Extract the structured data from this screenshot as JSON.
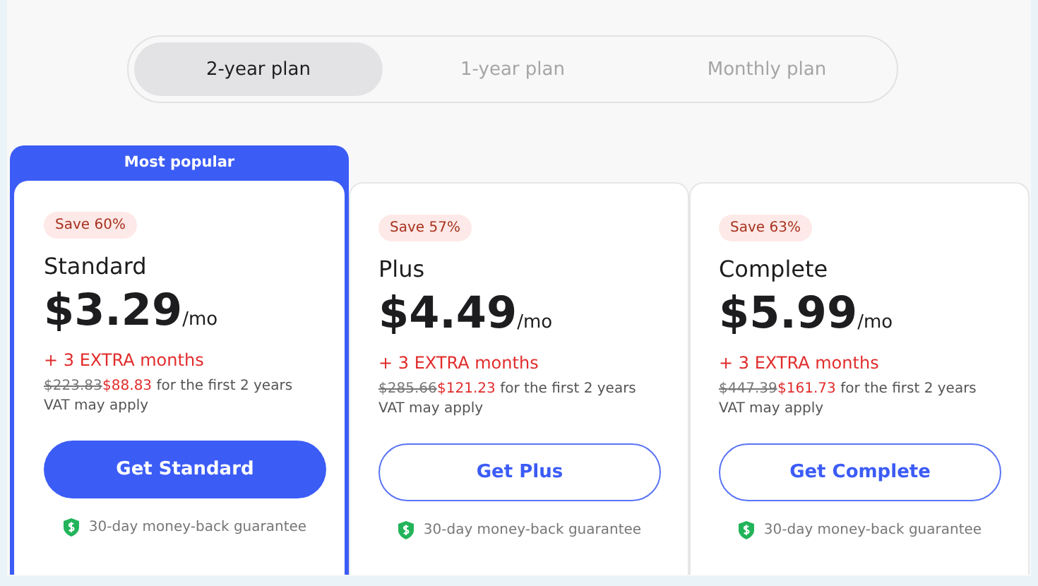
{
  "tabs": [
    {
      "label": "2-year plan",
      "selected": true
    },
    {
      "label": "1-year plan",
      "selected": false
    },
    {
      "label": "Monthly plan",
      "selected": false
    }
  ],
  "plans": [
    {
      "featured": true,
      "ribbon": "Most popular",
      "save": "Save 60%",
      "name": "Standard",
      "price": "$3.29",
      "unit": "/mo",
      "extra": "+ 3 EXTRA months",
      "old_price": "$223.83",
      "new_price": "$88.83",
      "period": "for the first 2 years",
      "vat": "VAT may apply",
      "button": "Get Standard",
      "guarantee": "30-day money-back guarantee"
    },
    {
      "featured": false,
      "save": "Save 57%",
      "name": "Plus",
      "price": "$4.49",
      "unit": "/mo",
      "extra": "+ 3 EXTRA months",
      "old_price": "$285.66",
      "new_price": "$121.23",
      "period": "for the first 2 years",
      "vat": "VAT may apply",
      "button": "Get Plus",
      "guarantee": "30-day money-back guarantee"
    },
    {
      "featured": false,
      "save": "Save 63%",
      "name": "Complete",
      "price": "$5.99",
      "unit": "/mo",
      "extra": "+ 3 EXTRA months",
      "old_price": "$447.39",
      "new_price": "$161.73",
      "period": "for the first 2 years",
      "vat": "VAT may apply",
      "button": "Get Complete",
      "guarantee": "30-day money-back guarantee"
    }
  ]
}
